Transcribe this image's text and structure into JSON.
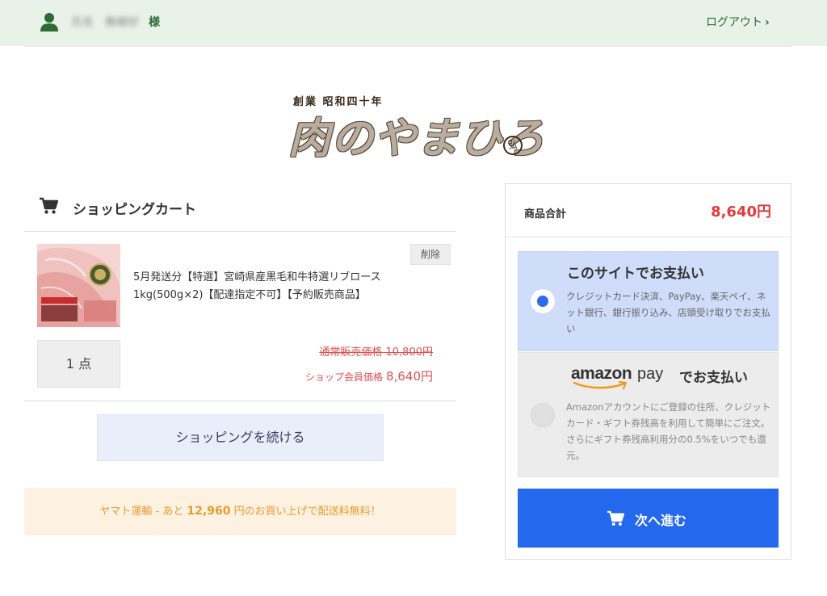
{
  "header": {
    "user_name": "氏名　無線好",
    "honorific": "様",
    "logout_label": "ログアウト",
    "logout_chevron": "›"
  },
  "logo": {
    "tagline": "創業 昭和四十年",
    "brand": "肉のやまひろ",
    "seal": "弘"
  },
  "cart": {
    "title": "ショッピングカート",
    "items": [
      {
        "name": "5月発送分【特選】宮崎県産黒毛和牛特選リブロース1kg(500g×2)【配達指定不可】【予約販売商品】",
        "delete_label": "削除",
        "quantity_label": "1 点",
        "regular_price_label": "通常販売価格 10,800円",
        "member_price_label": "ショップ会員価格",
        "member_price": "8,640円"
      }
    ],
    "continue_label": "ショッピングを続ける",
    "shipping_notice": {
      "prefix": "ヤマト運輸 - あと ",
      "amount": "12,960",
      "suffix": " 円のお買い上げで配送料無料！"
    }
  },
  "summary": {
    "total_label": "商品合計",
    "total_value": "8,640円",
    "payment_options": [
      {
        "title": "このサイトでお支払い",
        "description": "クレジットカード決済、PayPay、楽天ペイ、ネット銀行、銀行振り込み、店頭受け取りでお支払い",
        "selected": true
      },
      {
        "logo_word": "amazon",
        "logo_pay": "pay",
        "title_suffix": "でお支払い",
        "description": "Amazonアカウントにご登録の住所、クレジットカード・ギフト券残高を利用して簡単にご注文。さらにギフト券残高利用分の0.5%をいつでも還元。",
        "selected": false
      }
    ],
    "next_label": "次へ進む"
  },
  "colors": {
    "accent_green": "#2e6b35",
    "price_red": "#e13b3b",
    "primary_blue": "#2468ee",
    "notice_orange": "#e89a2d"
  },
  "icons": {
    "user": "user-icon",
    "cart": "cart-icon",
    "next_cart": "cart-icon"
  }
}
